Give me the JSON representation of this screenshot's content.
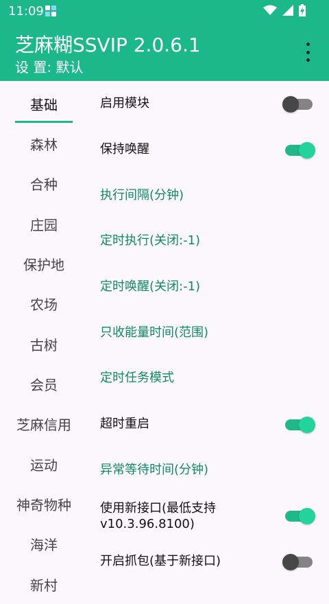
{
  "status_bar": {
    "time": "11:09"
  },
  "header": {
    "title": "芝麻糊SSVIP 2.0.6.1",
    "subtitle": "设 置: 默认"
  },
  "colors": {
    "primary": "#1DB88A",
    "link": "#0E8A68",
    "switch_on": "#21B889",
    "switch_off": "#474747"
  },
  "sidebar": {
    "items": [
      {
        "label": "基础"
      },
      {
        "label": "森林"
      },
      {
        "label": "合种"
      },
      {
        "label": "庄园"
      },
      {
        "label": "保护地"
      },
      {
        "label": "农场"
      },
      {
        "label": "古树"
      },
      {
        "label": "会员"
      },
      {
        "label": "芝麻信用"
      },
      {
        "label": "运动"
      },
      {
        "label": "神奇物种"
      },
      {
        "label": "海洋"
      },
      {
        "label": "新村"
      }
    ]
  },
  "settings": {
    "items": [
      {
        "label": "启用模块",
        "kind": "switch",
        "checked": false
      },
      {
        "label": "保持唤醒",
        "kind": "switch",
        "checked": true
      },
      {
        "label": "执行间隔(分钟)",
        "kind": "link"
      },
      {
        "label": "定时执行(关闭:-1)",
        "kind": "link"
      },
      {
        "label": "定时唤醒(关闭:-1)",
        "kind": "link"
      },
      {
        "label": "只收能量时间(范围)",
        "kind": "link"
      },
      {
        "label": "定时任务模式",
        "kind": "link"
      },
      {
        "label": "超时重启",
        "kind": "switch",
        "checked": true
      },
      {
        "label": "异常等待时间(分钟)",
        "kind": "link"
      },
      {
        "label_line1": "使用新接口(最低支持",
        "label_line2": "v10.3.96.8100)",
        "kind": "switch",
        "checked": true
      },
      {
        "label": "开启抓包(基于新接口)",
        "kind": "switch",
        "checked": false
      }
    ]
  }
}
